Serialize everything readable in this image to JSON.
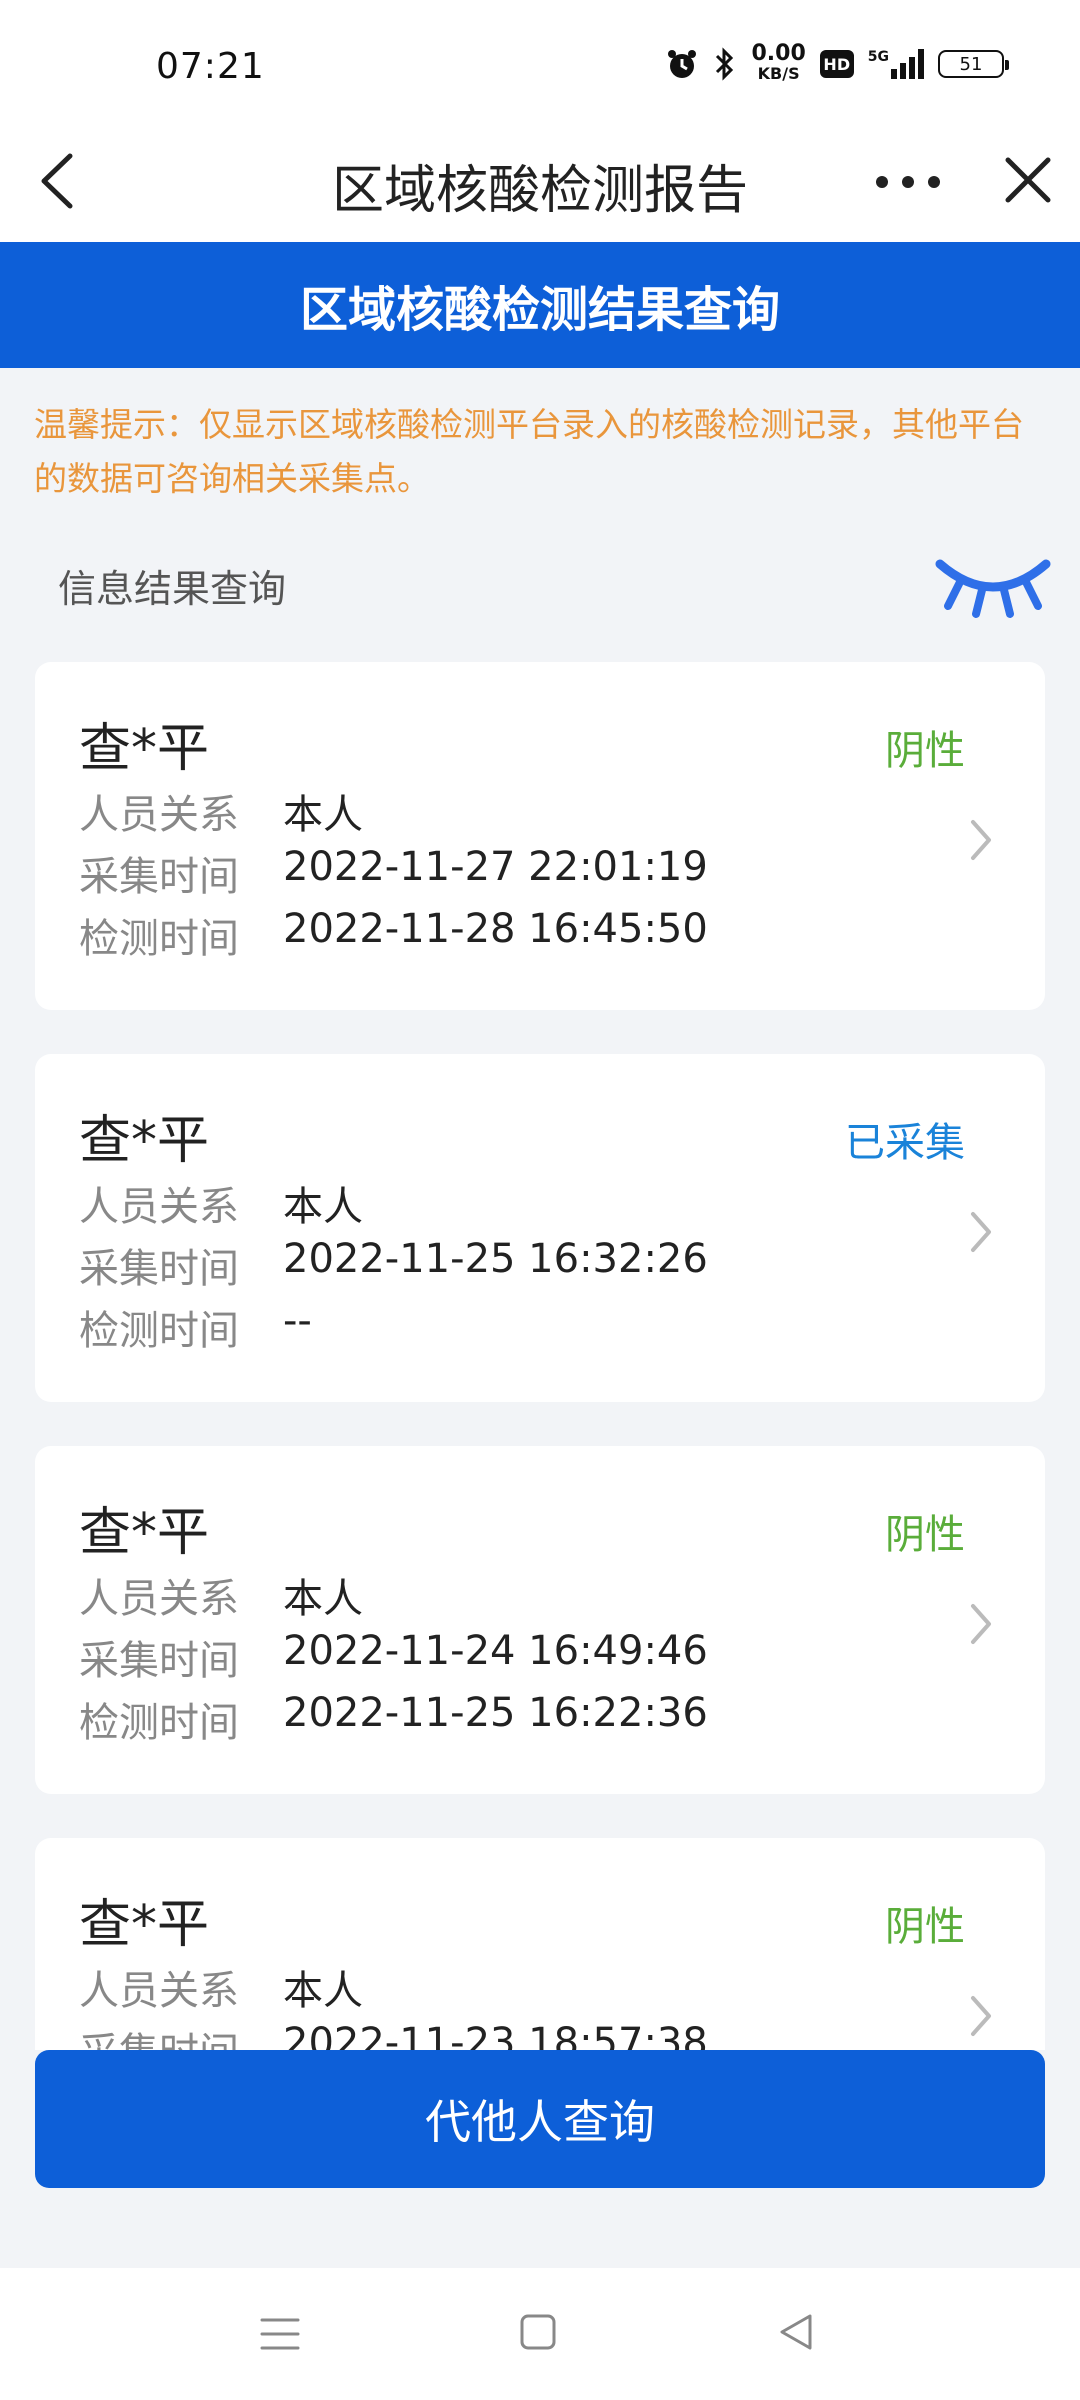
{
  "status_bar": {
    "time": "07:21",
    "net_speed_value": "0.00",
    "net_speed_unit": "KB/S",
    "hd_label": "HD",
    "network_label": "5G",
    "battery": "51",
    "icons": [
      "alarm-icon",
      "bluetooth-icon",
      "signal-icon",
      "battery-icon"
    ]
  },
  "nav": {
    "title": "区域核酸检测报告",
    "icons": [
      "back-icon",
      "more-icon",
      "close-icon"
    ]
  },
  "header": {
    "title": "区域核酸检测结果查询"
  },
  "tip": {
    "text": "温馨提示：仅显示区域核酸检测平台录入的核酸检测记录，其他平台的数据可咨询相关采集点。"
  },
  "section": {
    "title": "信息结果查询",
    "eye_icon": "eye-closed-icon"
  },
  "labels": {
    "relation": "人员关系",
    "collect_time": "采集时间",
    "test_time": "检测时间"
  },
  "records": [
    {
      "name": "查*平",
      "status": "阴性",
      "status_color": "#5aad3a",
      "relation": "本人",
      "collect_time": "2022-11-27 22:01:19",
      "test_time": "2022-11-28 16:45:50"
    },
    {
      "name": "查*平",
      "status": "已采集",
      "status_color": "#1a83d9",
      "relation": "本人",
      "collect_time": "2022-11-25 16:32:26",
      "test_time": "--"
    },
    {
      "name": "查*平",
      "status": "阴性",
      "status_color": "#5aad3a",
      "relation": "本人",
      "collect_time": "2022-11-24 16:49:46",
      "test_time": "2022-11-25 16:22:36"
    },
    {
      "name": "查*平",
      "status": "阴性",
      "status_color": "#5aad3a",
      "relation": "本人",
      "collect_time": "2022-11-23 18:57:38",
      "test_time": ""
    }
  ],
  "bottom": {
    "button_label": "代他人查询"
  },
  "colors": {
    "primary": "#0d5fd8",
    "tip": "#e9963c",
    "negative": "#5aad3a",
    "collected": "#1a83d9",
    "background": "#f2f4f7"
  }
}
